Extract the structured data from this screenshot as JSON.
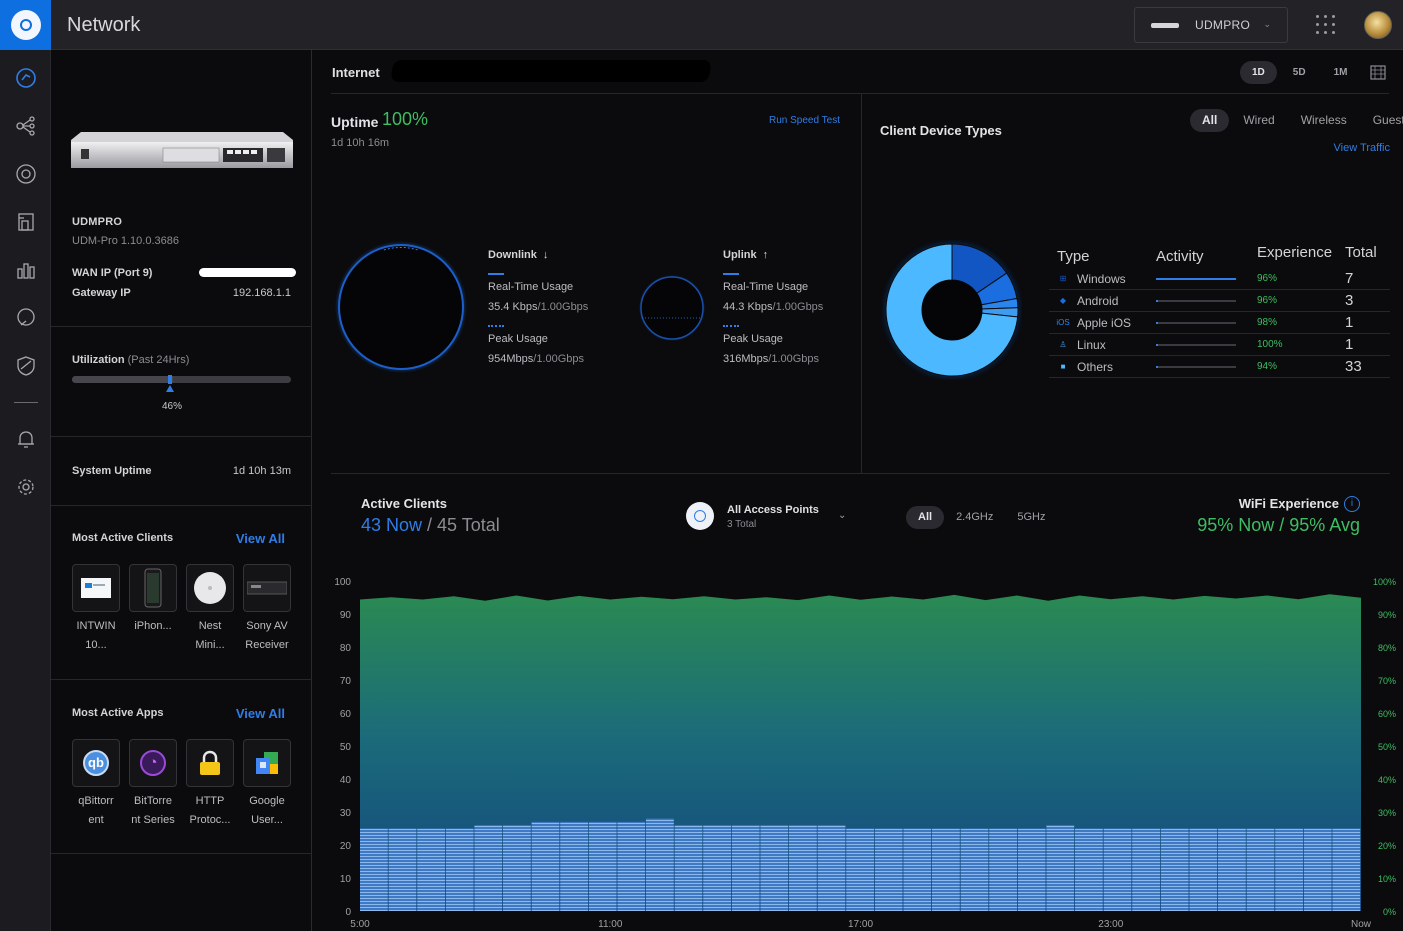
{
  "header": {
    "app_title": "Network",
    "device_select": "UDMPRO",
    "icons": [
      "ubiquiti-logo-icon",
      "apps-grid-icon",
      "user-avatar"
    ]
  },
  "nav_icons": [
    "dashboard-icon",
    "topology-icon",
    "devices-icon",
    "clients-icon",
    "statistics-icon",
    "insights-icon",
    "security-icon",
    "alerts-icon",
    "settings-icon"
  ],
  "device": {
    "name": "UDMPRO",
    "model": "UDM-Pro 1.10.0.3686",
    "wan_label": "WAN IP (Port 9)",
    "gateway_label": "Gateway IP",
    "gateway_ip": "192.168.1.1",
    "utilization_label": "Utilization",
    "utilization_period": "(Past 24Hrs)",
    "utilization_value": "46%",
    "utilization_fraction": 0.46,
    "system_uptime_label": "System Uptime",
    "system_uptime_value": "1d 10h 13m"
  },
  "most_active_clients": {
    "title": "Most Active Clients",
    "view_all": "View All",
    "items": [
      {
        "label": "INTWIN\n10..."
      },
      {
        "label": "iPhon..."
      },
      {
        "label": "Nest\nMini..."
      },
      {
        "label": "Sony AV\nReceiver"
      }
    ]
  },
  "most_active_apps": {
    "title": "Most Active Apps",
    "view_all": "View All",
    "items": [
      {
        "label": "qBittorr\nent",
        "glyph": "qb"
      },
      {
        "label": "BitTorre\nnt Series",
        "glyph": "◔"
      },
      {
        "label": "HTTP\nProtoc..."
      },
      {
        "label": "Google\nUser..."
      }
    ]
  },
  "internet": {
    "label": "Internet",
    "range_tabs": [
      "1D",
      "5D",
      "1M"
    ],
    "active_range": "1D",
    "uptime_label": "Uptime",
    "uptime_value": "100%",
    "uptime_duration": "1d 10h 16m",
    "speed_test": "Run Speed Test",
    "downlink": {
      "label": "Downlink",
      "arrow": "↓",
      "realtime_label": "Real-Time Usage",
      "realtime_value": "35.4 Kbps",
      "realtime_cap": "/1.00Gbps",
      "peak_label": "Peak Usage",
      "peak_value": "954Mbps",
      "peak_cap": "/1.00Gbps"
    },
    "uplink": {
      "label": "Uplink",
      "arrow": "↑",
      "realtime_label": "Real-Time Usage",
      "realtime_value": "44.3 Kbps",
      "realtime_cap": "/1.00Gbps",
      "peak_label": "Peak Usage",
      "peak_value": "316Mbps",
      "peak_cap": "/1.00Gbps"
    }
  },
  "client_device_types": {
    "title": "Client Device Types",
    "tabs": [
      "All",
      "Wired",
      "Wireless",
      "Guest"
    ],
    "active_tab": "All",
    "view_traffic": "View Traffic",
    "columns": [
      "Type",
      "Activity",
      "Experience",
      "Total"
    ],
    "rows": [
      {
        "type": "Windows",
        "icon": "windows-icon",
        "glyph": "⊞",
        "activity": 1.0,
        "experience": "96%",
        "total": "7"
      },
      {
        "type": "Android",
        "icon": "android-icon",
        "glyph": "◆",
        "activity": 0.02,
        "experience": "96%",
        "total": "3"
      },
      {
        "type": "Apple iOS",
        "icon": "apple-ios-icon",
        "glyph": "iOS",
        "activity": 0.02,
        "experience": "98%",
        "total": "1"
      },
      {
        "type": "Linux",
        "icon": "linux-icon",
        "glyph": "♙",
        "activity": 0.02,
        "experience": "100%",
        "total": "1"
      },
      {
        "type": "Others",
        "icon": "others-icon",
        "glyph": "■",
        "activity": 0.02,
        "experience": "94%",
        "total": "33"
      }
    ],
    "colors": {
      "Windows": "#1256c4",
      "Android": "#1a6ee0",
      "Apple iOS": "#2a86ec",
      "Linux": "#3d9cf2",
      "Others": "#4cb8ff"
    }
  },
  "active_clients": {
    "title": "Active Clients",
    "now_value": "43 Now",
    "total_value": "/ 45 Total",
    "ap_title": "All Access Points",
    "ap_sub": "3 Total",
    "band_tabs": [
      "All",
      "2.4GHz",
      "5GHz"
    ],
    "active_band": "All",
    "wifi_title": "WiFi Experience",
    "wifi_value": "95% Now / 95% Avg"
  },
  "chart_data": {
    "type": "area",
    "x_ticks": [
      "5:00",
      "11:00",
      "17:00",
      "23:00",
      "Now"
    ],
    "y_left_ticks": [
      "100",
      "90",
      "80",
      "70",
      "60",
      "50",
      "40",
      "30",
      "20",
      "10",
      "0"
    ],
    "y_right_ticks": [
      "100%",
      "90%",
      "80%",
      "70%",
      "60%",
      "50%",
      "40%",
      "30%",
      "20%",
      "10%",
      "0%"
    ],
    "ylim_left": [
      0,
      100
    ],
    "ylim_right": [
      0,
      100
    ],
    "series": [
      {
        "name": "",
        "kind": "area",
        "color": "#2a8a52",
        "values": [
          95,
          94.5,
          95,
          94.8,
          94.6,
          95,
          94.7,
          94.9,
          95,
          94.6,
          95.1,
          94.8,
          95,
          94.5,
          94.8,
          95,
          94.9,
          94.7,
          95,
          95.2,
          94.8,
          95,
          94.6,
          95,
          95.1,
          94.8,
          95,
          94.9,
          95.3,
          95,
          95.1,
          95.4,
          95.5
        ]
      },
      {
        "name": "",
        "kind": "bar",
        "color": "#6aa3e8",
        "values": [
          25,
          25,
          25,
          25,
          26,
          26,
          27,
          27,
          27,
          27,
          28,
          26,
          26,
          26,
          26,
          26,
          26,
          25,
          25,
          25,
          25,
          25,
          25,
          25,
          26,
          25,
          25,
          25,
          25,
          25,
          25,
          25,
          25,
          25,
          25
        ]
      }
    ]
  }
}
